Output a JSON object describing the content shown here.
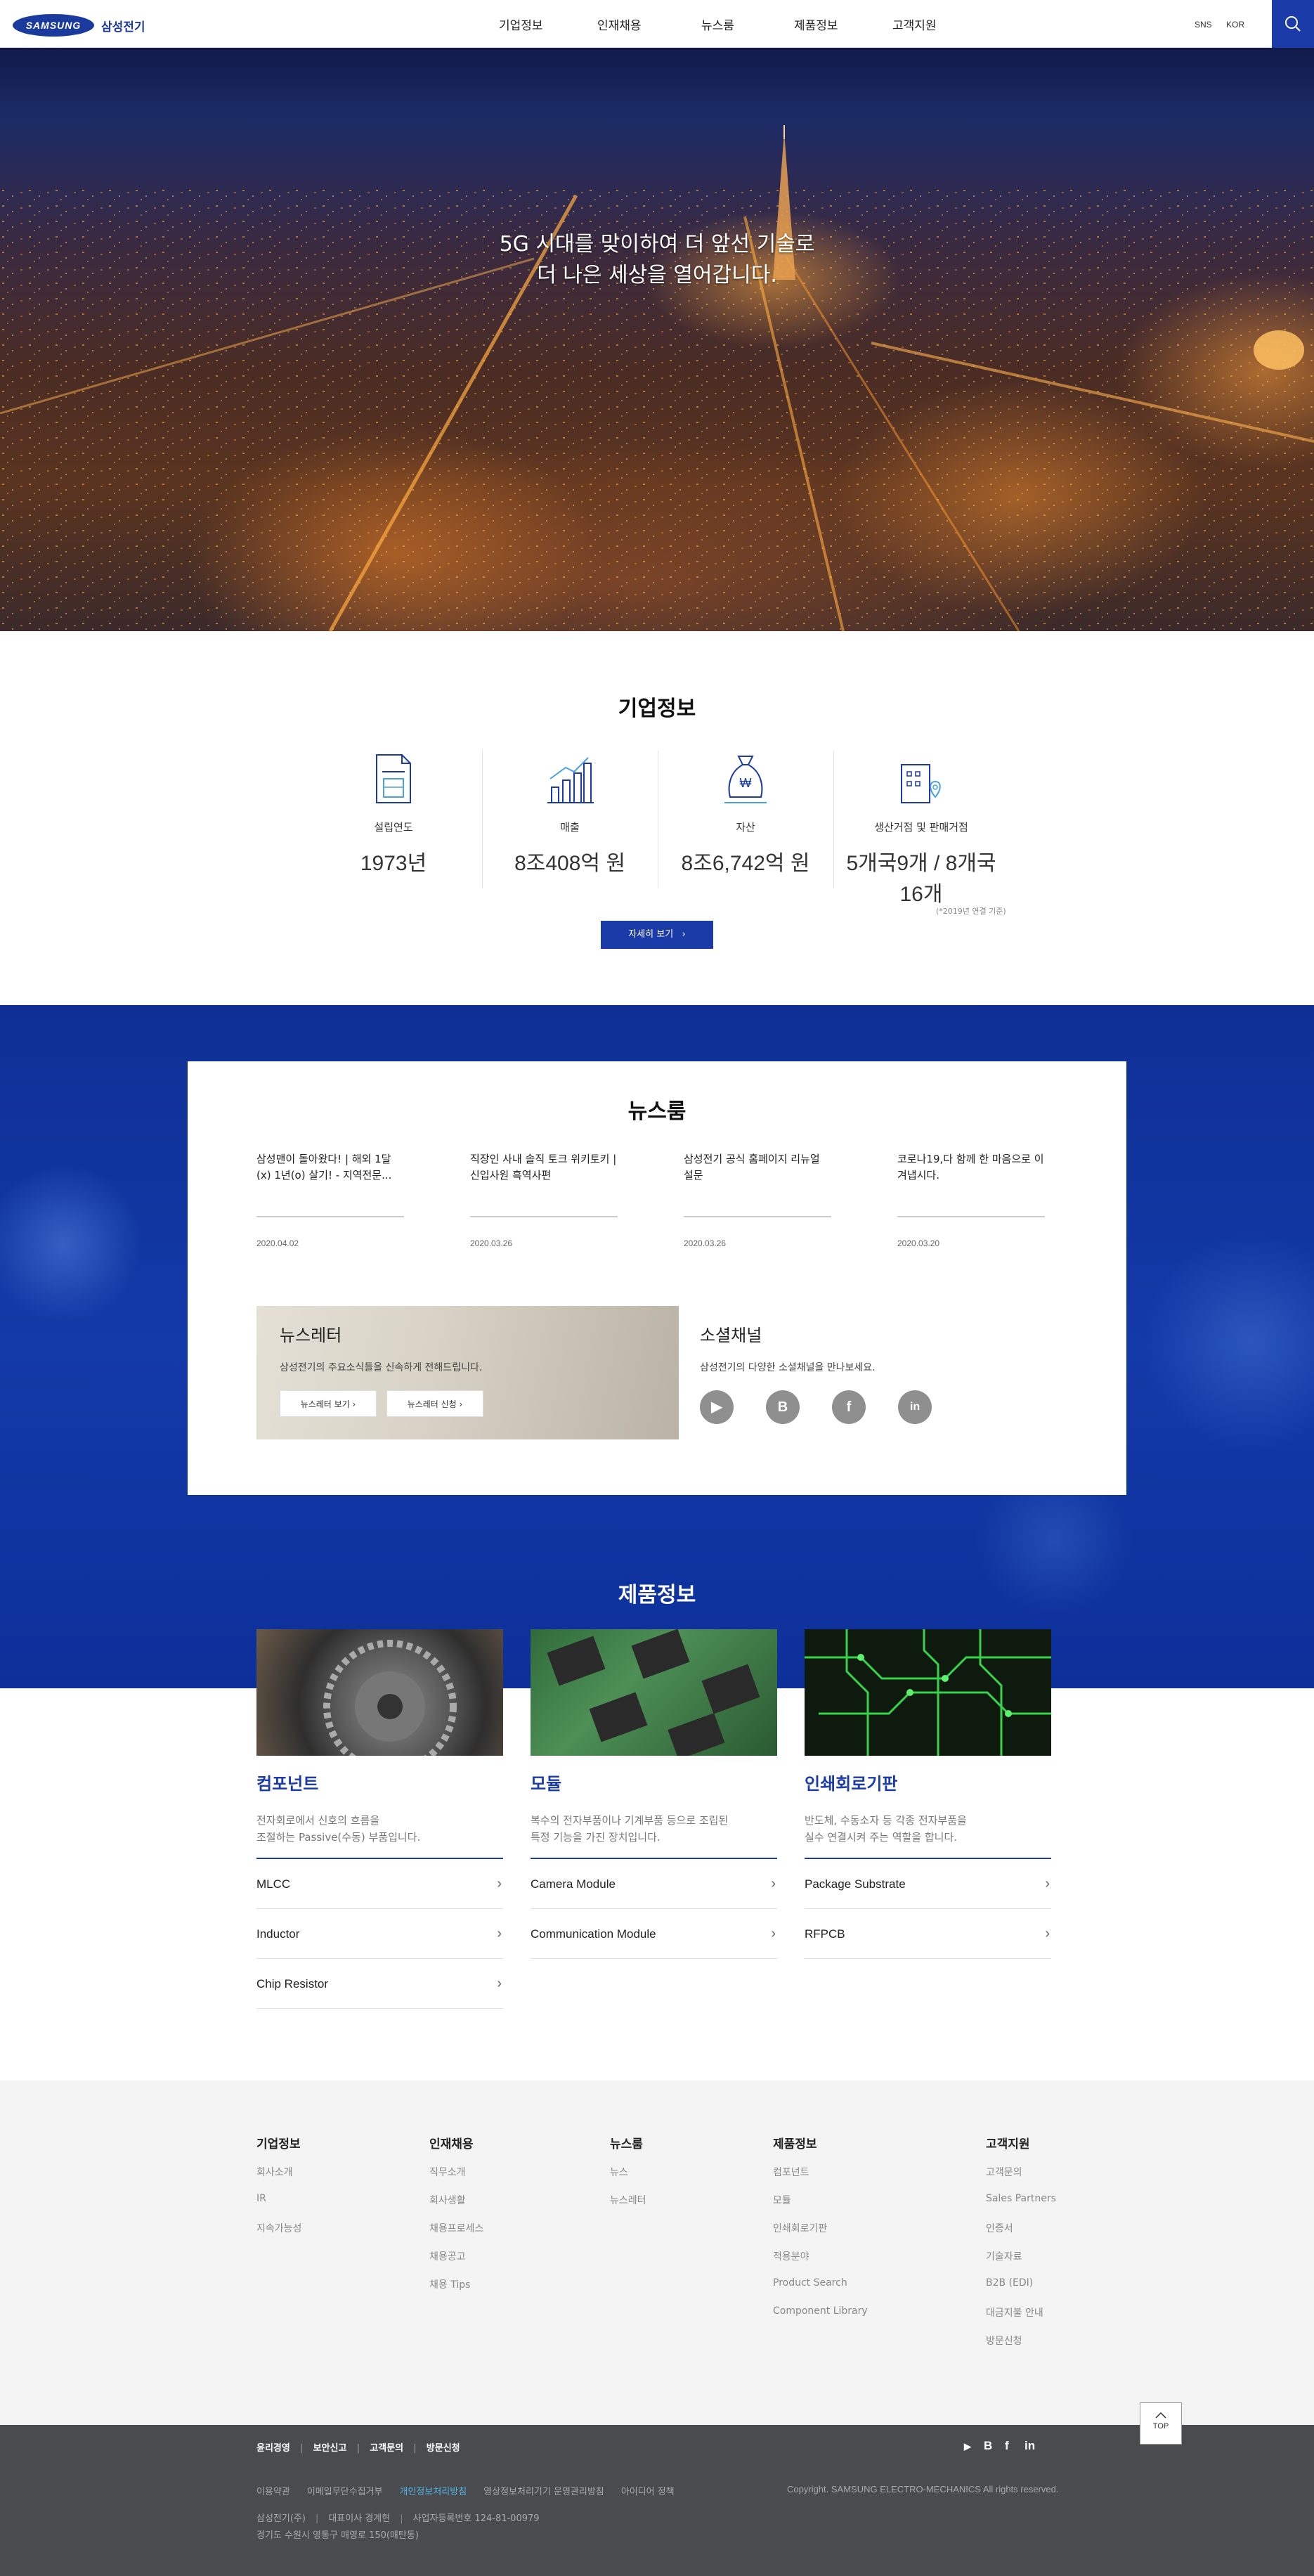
{
  "header": {
    "logo": "SAMSUNG",
    "brand": "삼성전기",
    "nav": [
      "기업정보",
      "인재채용",
      "뉴스룸",
      "제품정보",
      "고객지원"
    ],
    "util": [
      "SNS",
      "KOR"
    ]
  },
  "hero": {
    "line1": "5G 시대를 맞이하여 더 앞선 기술로",
    "line2": "더 나은 세상을 열어갑니다."
  },
  "company": {
    "title": "기업정보",
    "items": [
      {
        "label": "설립연도",
        "value": "1973년"
      },
      {
        "label": "매출",
        "value": "8조408억 원"
      },
      {
        "label": "자산",
        "value": "8조6,742억 원"
      },
      {
        "label": "생산거점 및 판매거점",
        "value": "5개국9개 / 8개국 16개"
      }
    ],
    "note": "(*2019년 연결 기준)",
    "more": "자세히 보기"
  },
  "colors": {
    "primary": "#1b3ba8",
    "blue_bg": "#123aa8"
  },
  "news": {
    "title": "뉴스룸",
    "items": [
      {
        "title": "삼성맨이 돌아왔다! | 해외 1달(x) 1년(o) 살기! - 지역전문...",
        "date": "2020.04.02"
      },
      {
        "title": "직장인 사내 솔직 토크 위키토키 | 신입사원 흑역사편",
        "date": "2020.03.26"
      },
      {
        "title": "삼성전기 공식 홈페이지 리뉴얼 설문",
        "date": "2020.03.26"
      },
      {
        "title": "코로나19,다 함께 한 마음으로 이겨냅시다.",
        "date": "2020.03.20"
      }
    ],
    "newsletter": {
      "title": "뉴스레터",
      "desc": "삼성전기의 주요소식들을 신속하게 전해드립니다.",
      "btn1": "뉴스레터 보기",
      "btn2": "뉴스레터 신청"
    },
    "social": {
      "title": "소셜채널",
      "desc": "삼성전기의 다양한 소셜채널을 만나보세요.",
      "icons": [
        "▶",
        "B",
        "f",
        "in"
      ]
    }
  },
  "products": {
    "title": "제품정보",
    "items": [
      {
        "name": "컴포넌트",
        "desc1": "전자회로에서 신호의 흐름을",
        "desc2": "조절하는 Passive(수동) 부품입니다.",
        "links": [
          "MLCC",
          "Inductor",
          "Chip Resistor"
        ]
      },
      {
        "name": "모듈",
        "desc1": "복수의 전자부품이나 기계부품 등으로 조립된",
        "desc2": "특정 기능을 가진 장치입니다.",
        "links": [
          "Camera Module",
          "Communication Module"
        ]
      },
      {
        "name": "인쇄회로기판",
        "desc1": "반도체, 수동소자 등 각종 전자부품을",
        "desc2": "실수 연결시켜 주는 역할을 합니다.",
        "links": [
          "Package Substrate",
          "RFPCB"
        ]
      }
    ]
  },
  "sitemap": [
    {
      "head": "기업정보",
      "items": [
        "회사소개",
        "IR",
        "지속가능성"
      ]
    },
    {
      "head": "인재채용",
      "items": [
        "직무소개",
        "회사생활",
        "채용프로세스",
        "채용공고",
        "채용 Tips"
      ]
    },
    {
      "head": "뉴스룸",
      "items": [
        "뉴스",
        "뉴스레터"
      ]
    },
    {
      "head": "제품정보",
      "items": [
        "컴포넌트",
        "모듈",
        "인쇄회로기판",
        "적용분야",
        "Product Search",
        "Component Library"
      ]
    },
    {
      "head": "고객지원",
      "items": [
        "고객문의",
        "Sales Partners",
        "인증서",
        "기술자료",
        "B2B (EDI)",
        "대금지불 안내",
        "방문신청"
      ]
    }
  ],
  "top": "TOP",
  "footer": {
    "links": [
      "윤리경영",
      "보안신고",
      "고객문의",
      "방문신청"
    ],
    "policies": [
      "이용약관",
      "이메일무단수집거부",
      "개인정보처리방침",
      "영상정보처리기기 운영관리방침",
      "아이디어 정책"
    ],
    "copyright": "Copyright. SAMSUNG ELECTRO-MECHANICS All rights reserved.",
    "company": "삼성전기(주)",
    "ceo": "대표이사 경계현",
    "bizno": "사업자등록번호 124-81-00979",
    "address": "경기도 수원시 영통구 매영로 150(매탄동)",
    "social": [
      "▶",
      "B",
      "f",
      "in"
    ]
  }
}
